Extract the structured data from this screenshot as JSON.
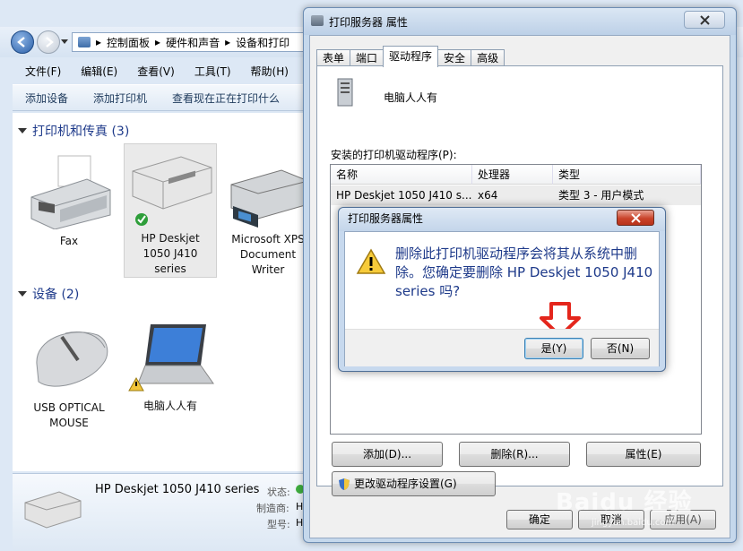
{
  "explorer": {
    "address_segments": [
      "控制面板",
      "硬件和声音",
      "设备和打印"
    ],
    "menu": [
      "文件(F)",
      "编辑(E)",
      "查看(V)",
      "工具(T)",
      "帮助(H)"
    ],
    "commands": [
      "添加设备",
      "添加打印机",
      "查看现在正在打印什么"
    ],
    "group_printers": "打印机和传真 (3)",
    "group_devices": "设备 (2)",
    "printers": [
      {
        "label": [
          "Fax"
        ]
      },
      {
        "label": [
          "HP Deskjet",
          "1050 J410",
          "series"
        ]
      },
      {
        "label": [
          "Microsoft XPS",
          "Document",
          "Writer"
        ]
      }
    ],
    "devices": [
      {
        "label": [
          "USB OPTICAL",
          "MOUSE"
        ]
      },
      {
        "label": [
          "电脑人人有"
        ]
      }
    ],
    "detail": {
      "name": "HP Deskjet 1050 J410 series",
      "status_label": "状态:",
      "maker_label": "制造商:",
      "maker_value": "H",
      "model_label": "型号:",
      "model_value": "H"
    }
  },
  "props": {
    "title": "打印服务器 属性",
    "tabs": [
      "表单",
      "端口",
      "驱动程序",
      "安全",
      "高级"
    ],
    "active_tab": "驱动程序",
    "server_name": "电脑人人有",
    "installed_label": "安装的打印机驱动程序(P):",
    "columns": [
      "名称",
      "处理器",
      "类型"
    ],
    "rows": [
      {
        "name": "HP Deskjet 1050 J410 s...",
        "processor": "x64",
        "type": "类型 3 - 用户模式"
      }
    ],
    "buttons": {
      "add": "添加(D)...",
      "remove": "删除(R)...",
      "properties": "属性(E)"
    },
    "change_settings": "更改驱动程序设置(G)",
    "ok": "确定",
    "cancel": "取消",
    "apply": "应用(A)"
  },
  "confirm": {
    "title": "打印服务器属性",
    "message": "删除此打印机驱动程序会将其从系统中删除。您确定要删除 HP Deskjet 1050 J410 series 吗?",
    "yes": "是(Y)",
    "no": "否(N)"
  },
  "watermark": {
    "text": "Baidu 经验",
    "url": "jingyan.baidu.com"
  }
}
